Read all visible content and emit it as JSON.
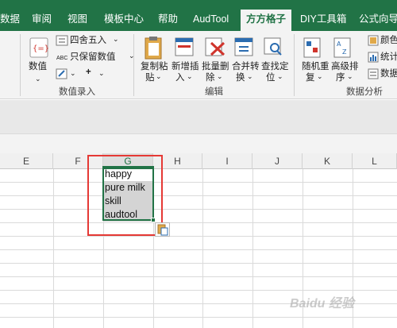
{
  "window_title": "",
  "tabs": [
    "数据",
    "审阅",
    "视图",
    "模板中心",
    "帮助",
    "AudTool",
    "方方格子",
    "DIY工具箱",
    "公式向导"
  ],
  "active_tab": "方方格子",
  "ribbon": {
    "value_button": "数值",
    "round_button": "四舍五入",
    "keep_value_button": "只保留数值",
    "plus_symbol": "+",
    "group_data_entry": "数值录入",
    "copy_paste": [
      "复制粘",
      "贴"
    ],
    "insert_new": [
      "新增插",
      "入"
    ],
    "batch_delete": [
      "批量删",
      "除"
    ],
    "merge_convert": [
      "合并转",
      "换"
    ],
    "find_locate": [
      "查找定",
      "位"
    ],
    "group_edit": "编辑",
    "random_repeat": [
      "随机重",
      "复"
    ],
    "advanced_sort": [
      "高级排",
      "序"
    ],
    "color_item": "颜色",
    "stats_item": "统计",
    "data_item": "数据",
    "group_analysis": "数据分析"
  },
  "columns": [
    "E",
    "F",
    "G",
    "H",
    "I",
    "J",
    "K",
    "L"
  ],
  "selected_column": "G",
  "cells": [
    "happy",
    "pure milk",
    "skill",
    "audtool"
  ],
  "watermark": "Baidu 经验"
}
